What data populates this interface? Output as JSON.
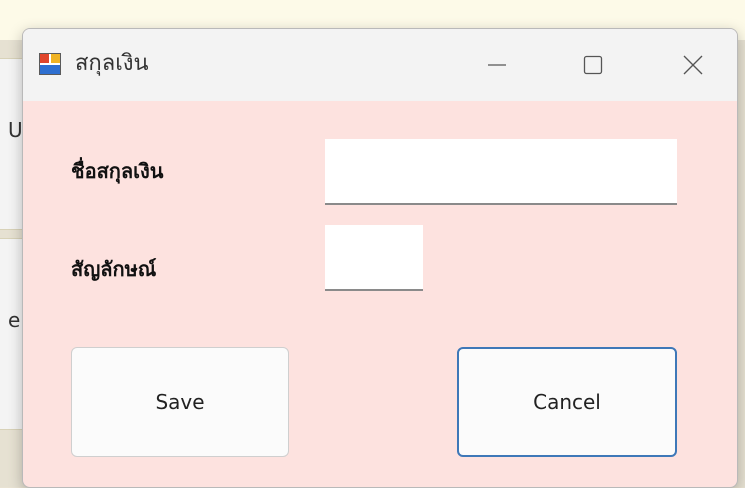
{
  "background": {
    "glyphs": [
      "U",
      "e"
    ]
  },
  "window": {
    "title": "สกุลเงิน",
    "icons": {
      "app": "app-window-icon",
      "minimize": "minimize-icon",
      "maximize": "maximize-icon",
      "close": "close-icon"
    }
  },
  "form": {
    "currency_name_label": "ชื่อสกุลเงิน",
    "currency_name_value": "",
    "symbol_label": "สัญลักษณ์",
    "symbol_value": ""
  },
  "buttons": {
    "save_label": "Save",
    "cancel_label": "Cancel"
  },
  "colors": {
    "window_bg": "#fde2df",
    "titlebar_bg": "#f3f3f3",
    "focus_border": "#3e78b8"
  }
}
